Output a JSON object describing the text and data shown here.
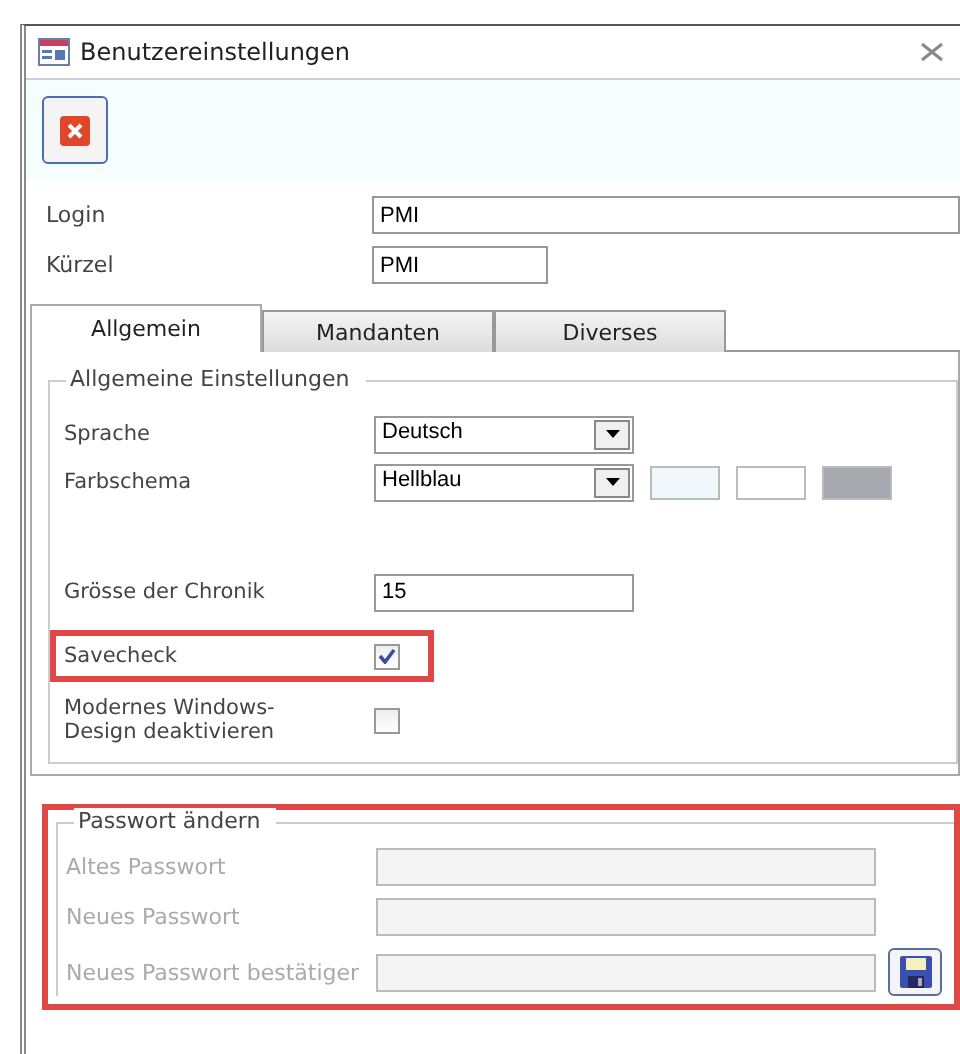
{
  "window": {
    "title": "Benutzereinstellungen"
  },
  "fields": [
    {
      "label": "Login",
      "value": "PMI",
      "kind": "wide"
    },
    {
      "label": "Kürzel",
      "value": "PMI",
      "kind": "short"
    }
  ],
  "tabs": [
    {
      "label": "Allgemein",
      "selected": true
    },
    {
      "label": "Mandanten",
      "selected": false
    },
    {
      "label": "Diverses",
      "selected": false
    }
  ],
  "general": {
    "legend": "Allgemeine Einstellungen",
    "rows": [
      {
        "kind": "select",
        "label": "Sprache",
        "value": "Deutsch"
      },
      {
        "kind": "select",
        "label": "Farbschema",
        "value": "Hellblau",
        "swatches": [
          {
            "color": "#f0f8fc"
          },
          {
            "color": "#ffffff"
          },
          {
            "color": "#a8a8b0"
          }
        ]
      },
      {
        "kind": "text",
        "label": "Grösse der Chronik",
        "value": "15"
      },
      {
        "kind": "checkbox",
        "label": "Savecheck",
        "checked": true,
        "highlighted": true
      },
      {
        "kind": "checkbox",
        "label": "Modernes Windows-Design deaktivieren",
        "checked": false,
        "highlighted": false
      }
    ]
  },
  "password": {
    "legend": "Passwort ändern",
    "highlighted": true,
    "fields": [
      {
        "label": "Altes Passwort",
        "disabled": true
      },
      {
        "label": "Neues Passwort",
        "disabled": true
      },
      {
        "label": "Neues Passwort bestätiger",
        "disabled": true
      }
    ]
  }
}
